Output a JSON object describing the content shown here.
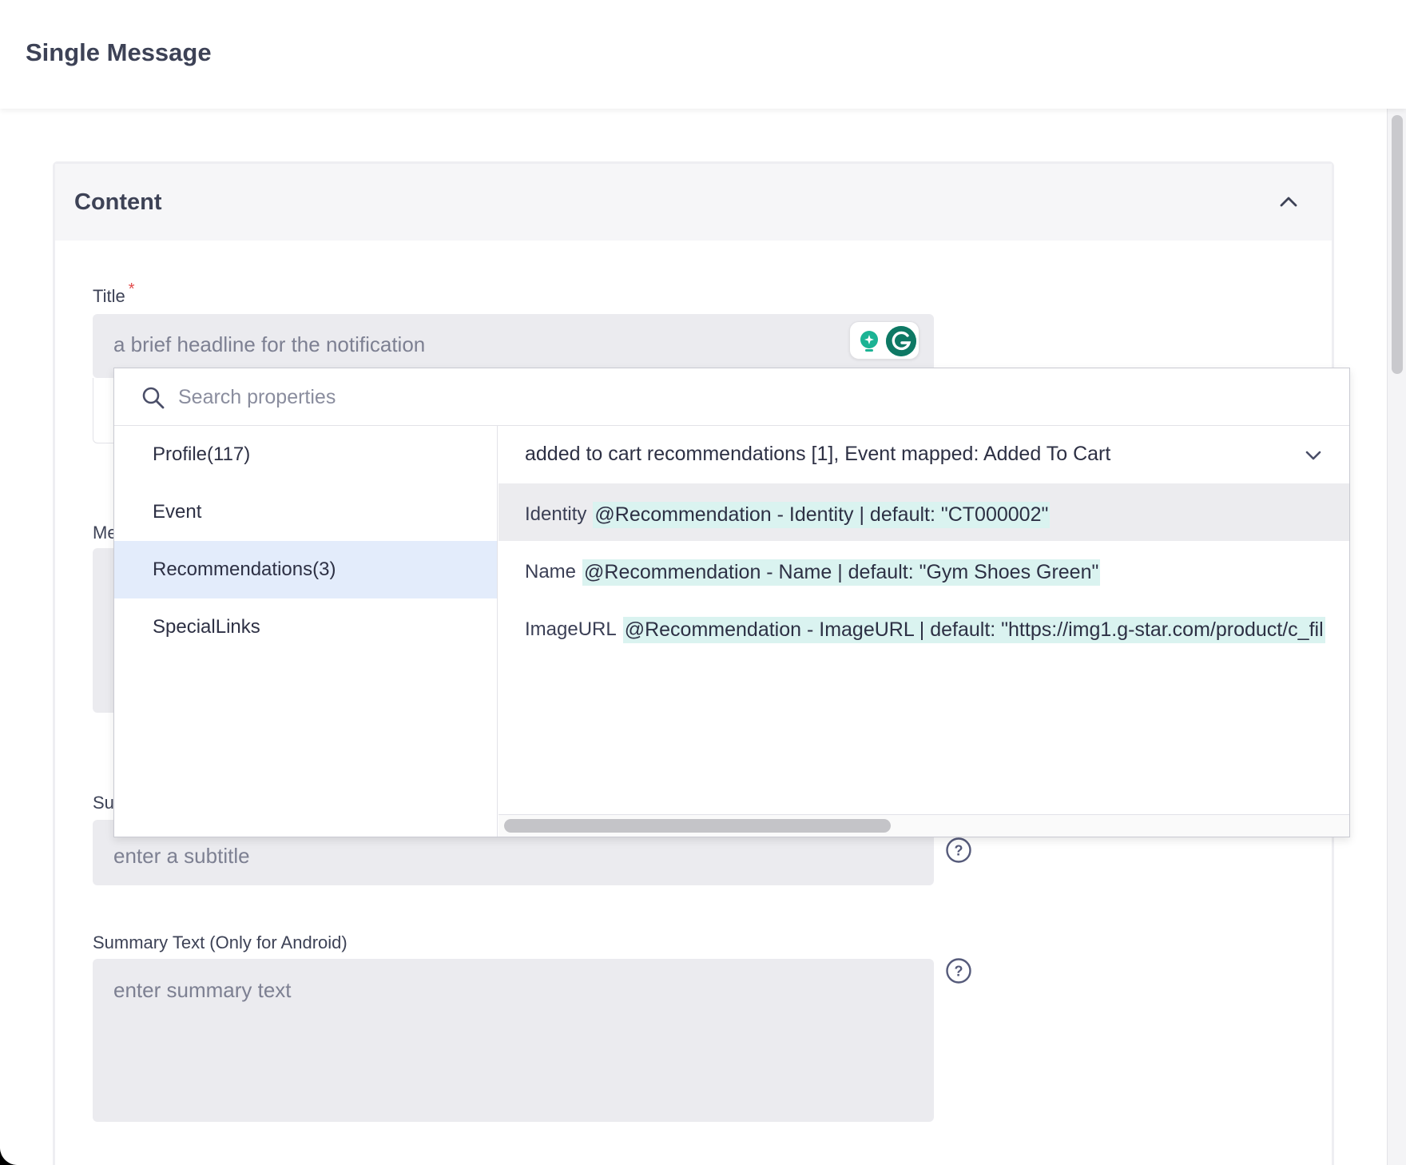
{
  "window": {
    "page_title": "Single Message"
  },
  "content_section": {
    "title": "Content",
    "fields": {
      "title_label": "Title",
      "title_required": "*",
      "title_placeholder": "a brief headline for the notification",
      "message_label_partial": "Me",
      "subtitle_label_partial": "Su",
      "subtitle_placeholder": "enter a subtitle",
      "summary_label": "Summary Text (Only for Android)",
      "summary_placeholder": "enter summary text"
    }
  },
  "property_picker": {
    "search_placeholder": "Search properties",
    "categories": [
      {
        "label": "Profile(117)",
        "active": false
      },
      {
        "label": "Event",
        "active": false
      },
      {
        "label": "Recommendations(3)",
        "active": true
      },
      {
        "label": "SpecialLinks",
        "active": false
      }
    ],
    "selected_event": "added to cart recommendations [1], Event mapped: Added To Cart",
    "properties": [
      {
        "name": "Identity",
        "token": "@Recommendation - Identity | default: \"CT000002\""
      },
      {
        "name": "Name",
        "token": "@Recommendation - Name | default: \"Gym Shoes Green\""
      },
      {
        "name": "ImageURL",
        "token": "@Recommendation - ImageURL | default: \"https://img1.g-star.com/product/c_fil"
      }
    ]
  },
  "icons": {
    "collapse": "chevron-up-icon",
    "search": "search-icon",
    "dropdown": "chevron-down-icon",
    "help": "help-icon",
    "grammarly": "grammarly-icon"
  },
  "colors": {
    "active_category_bg": "#e3ecfb",
    "token_highlight": "#daf3f0",
    "input_bg": "#ebebef",
    "required": "#e24b4b"
  }
}
